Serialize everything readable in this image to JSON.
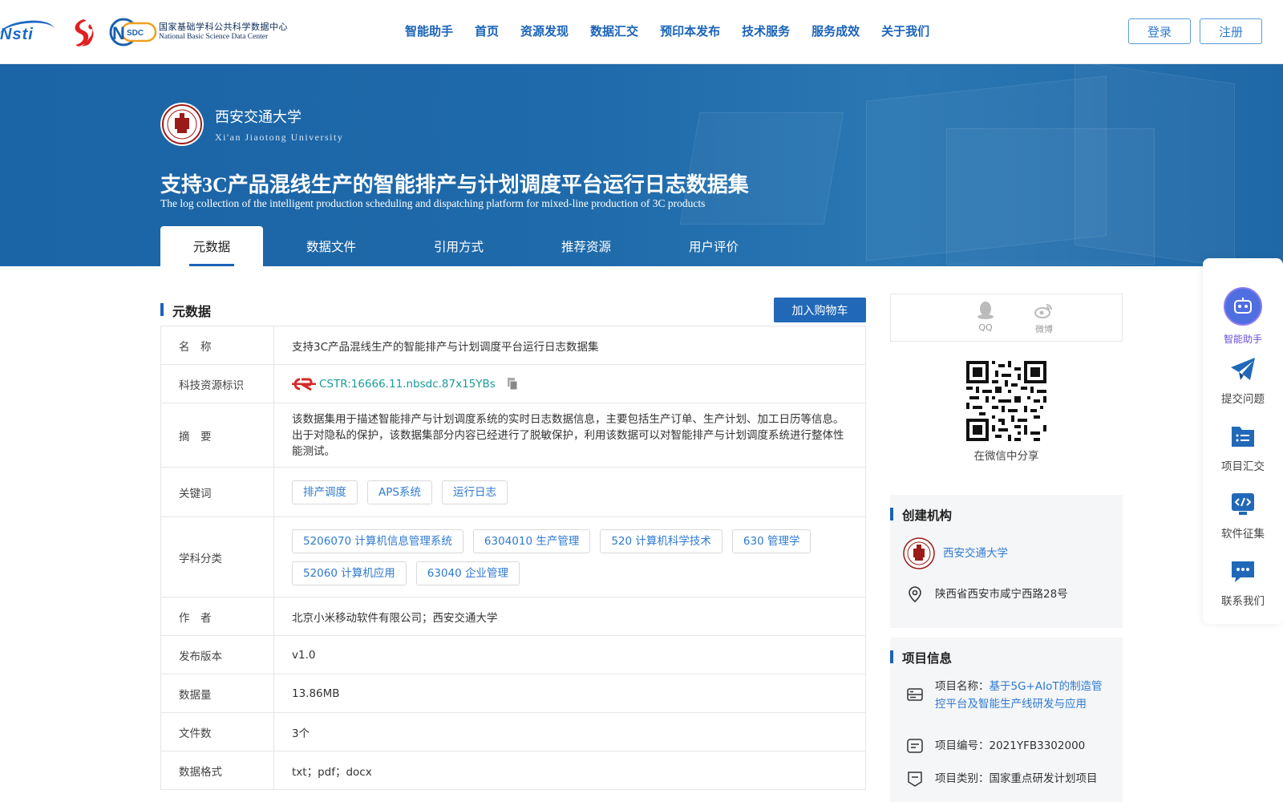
{
  "header": {
    "logos": {
      "nsti_text": "Nsti",
      "nsdc_badge": "NSDC",
      "nsdc_cn": "国家基础学科公共科学数据中心",
      "nsdc_en": "National Basic Science Data Center"
    },
    "nav": [
      "智能助手",
      "首页",
      "资源发现",
      "数据汇交",
      "预印本发布",
      "技术服务",
      "服务成效",
      "关于我们"
    ],
    "login_label": "登录",
    "register_label": "注册"
  },
  "banner": {
    "university_cn": "西安交通大学",
    "university_en": "Xi'an Jiaotong University",
    "title": "支持3C产品混线生产的智能排产与计划调度平台运行日志数据集",
    "subtitle": "The log collection of the intelligent production scheduling and dispatching platform for mixed-line production of 3C products",
    "tabs": [
      "元数据",
      "数据文件",
      "引用方式",
      "推荐资源",
      "用户评价"
    ],
    "active_tab": "元数据"
  },
  "metadata": {
    "section_title": "元数据",
    "cart_label": "加入购物车",
    "rows": {
      "name": {
        "label": "名　称",
        "value": "支持3C产品混线生产的智能排产与计划调度平台运行日志数据集"
      },
      "cstr": {
        "label": "科技资源标识",
        "value": "CSTR:16666.11.nbsdc.87x15YBs"
      },
      "abstract": {
        "label": "摘　要",
        "value": "该数据集用于描述智能排产与计划调度系统的实时日志数据信息，主要包括生产订单、生产计划、加工日历等信息。出于对隐私的保护，该数据集部分内容已经进行了脱敏保护，利用该数据可以对智能排产与计划调度系统进行整体性能测试。"
      },
      "keywords": {
        "label": "关键词",
        "values": [
          "排产调度",
          "APS系统",
          "运行日志"
        ]
      },
      "subjects": {
        "label": "学科分类",
        "values": [
          "5206070 计算机信息管理系统",
          "6304010 生产管理",
          "520 计算机科学技术",
          "630 管理学",
          "52060 计算机应用",
          "63040 企业管理"
        ]
      },
      "authors": {
        "label": "作　者",
        "value": "北京小米移动软件有限公司；西安交通大学"
      },
      "version": {
        "label": "发布版本",
        "value": "v1.0"
      },
      "size": {
        "label": "数据量",
        "value": "13.86MB"
      },
      "files": {
        "label": "文件数",
        "value": "3个"
      },
      "formats": {
        "label": "数据格式",
        "value": "txt；pdf；docx"
      }
    }
  },
  "share": {
    "qq_label": "QQ",
    "weibo_label": "微博",
    "wechat_label": "在微信中分享"
  },
  "institution": {
    "title": "创建机构",
    "name": "西安交通大学",
    "address": "陕西省西安市咸宁西路28号"
  },
  "project": {
    "title": "项目信息",
    "name_label": "项目名称：",
    "name_value_line1": "基于5G+AIoT的制造管",
    "name_value_line2": "控平台及智能生产线研发与应用",
    "number_label": "项目编号：",
    "number_value": "2021YFB3302000",
    "type_label": "项目类别：",
    "type_value": "国家重点研发计划项目"
  },
  "floating": {
    "items": [
      "智能助手",
      "提交问题",
      "项目汇交",
      "软件征集",
      "联系我们"
    ]
  },
  "colors": {
    "primary": "#1a63b8",
    "banner": "#1f6aaa",
    "link": "#2f7ad0",
    "cstr": "#1a9a9a"
  }
}
